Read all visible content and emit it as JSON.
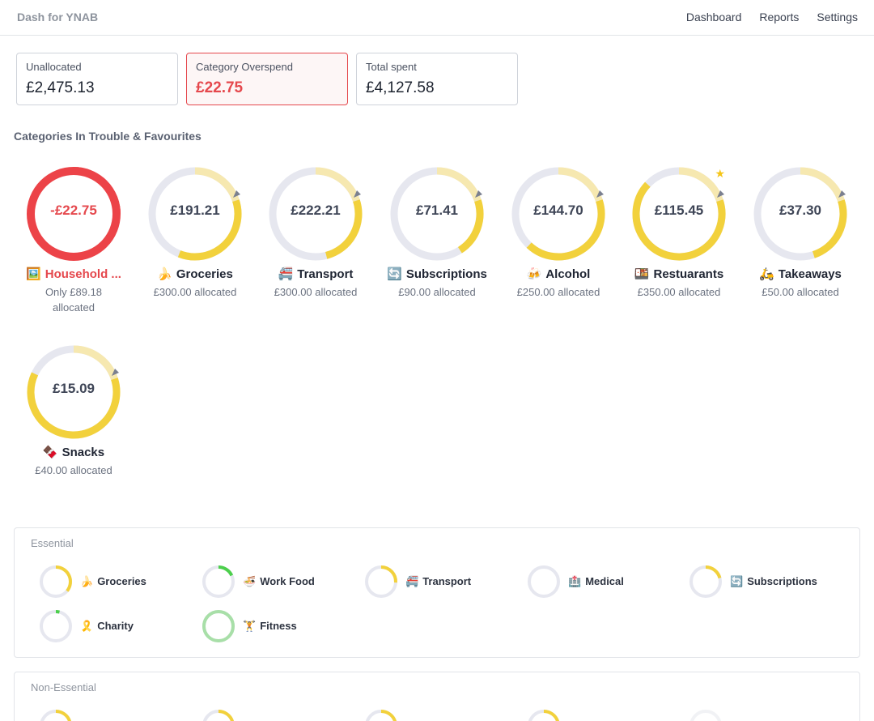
{
  "app": {
    "brand": "Dash for YNAB"
  },
  "nav": [
    {
      "label": "Dashboard"
    },
    {
      "label": "Reports"
    },
    {
      "label": "Settings"
    }
  ],
  "summary": [
    {
      "label": "Unallocated",
      "value": "£2,475.13",
      "alert": false
    },
    {
      "label": "Category Overspend",
      "value": "£22.75",
      "alert": true
    },
    {
      "label": "Total spent",
      "value": "£4,127.58",
      "alert": false
    }
  ],
  "trouble": {
    "title": "Categories In Trouble & Favourites",
    "items": [
      {
        "amount": "-£22.75",
        "name": "Household ...",
        "emoji": "🖼️",
        "sub": "Only £89.18 allocated",
        "fill": 1.0,
        "overspent": true,
        "favourite": false
      },
      {
        "amount": "£191.21",
        "name": "Groceries",
        "emoji": "🍌",
        "sub": "£300.00 allocated",
        "fill": 0.36,
        "overspent": false,
        "favourite": false
      },
      {
        "amount": "£222.21",
        "name": "Transport",
        "emoji": "🚝",
        "sub": "£300.00 allocated",
        "fill": 0.26,
        "overspent": false,
        "favourite": false
      },
      {
        "amount": "£71.41",
        "name": "Subscriptions",
        "emoji": "🔄",
        "sub": "£90.00 allocated",
        "fill": 0.21,
        "overspent": false,
        "favourite": false
      },
      {
        "amount": "£144.70",
        "name": "Alcohol",
        "emoji": "🍻",
        "sub": "£250.00 allocated",
        "fill": 0.42,
        "overspent": false,
        "favourite": false
      },
      {
        "amount": "£115.45",
        "name": "Restuarants",
        "emoji": "🍱",
        "sub": "£350.00 allocated",
        "fill": 0.67,
        "overspent": false,
        "favourite": true
      },
      {
        "amount": "£37.30",
        "name": "Takeaways",
        "emoji": "🛵",
        "sub": "£50.00 allocated",
        "fill": 0.25,
        "overspent": false,
        "favourite": false
      },
      {
        "amount": "£15.09",
        "name": "Snacks",
        "emoji": "🍫",
        "sub": "£40.00 allocated",
        "fill": 0.62,
        "overspent": false,
        "favourite": false
      }
    ]
  },
  "essential": {
    "title": "Essential",
    "items": [
      {
        "name": "Groceries",
        "emoji": "🍌",
        "fill": 0.36,
        "color": "#f2d13c"
      },
      {
        "name": "Work Food",
        "emoji": "🍜",
        "fill": 0.18,
        "color": "#4ccf4c"
      },
      {
        "name": "Transport",
        "emoji": "🚝",
        "fill": 0.26,
        "color": "#f2d13c"
      },
      {
        "name": "Medical",
        "emoji": "🏥",
        "fill": 0,
        "color": "#f2d13c"
      },
      {
        "name": "Subscriptions",
        "emoji": "🔄",
        "fill": 0.21,
        "color": "#f2d13c"
      },
      {
        "name": "Charity",
        "emoji": "🎗️",
        "fill": 0.04,
        "color": "#4ccf4c"
      },
      {
        "name": "Fitness",
        "emoji": "🏋️",
        "fill": 1.0,
        "color": "#a8dfa8"
      }
    ]
  },
  "nonessential": {
    "title": "Non-Essential",
    "items": [
      {
        "fill": 0.2,
        "color": "#f2d13c"
      },
      {
        "fill": 0.2,
        "color": "#f2d13c"
      },
      {
        "fill": 0.2,
        "color": "#f2d13c"
      },
      {
        "fill": 0.2,
        "color": "#f2d13c"
      },
      {
        "fill": 0,
        "color": "#f2d13c"
      }
    ]
  },
  "colors": {
    "track": "#e6e7ef",
    "budget": "#f6e8b0",
    "spend": "#f2d13c",
    "danger": "#ec4348",
    "marker": "#7b8090"
  }
}
